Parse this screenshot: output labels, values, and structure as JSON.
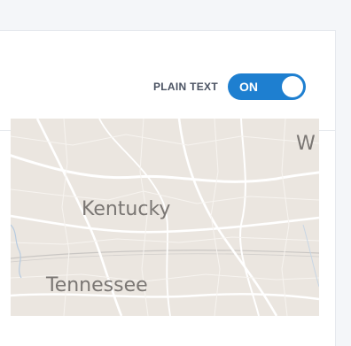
{
  "toolbar": {
    "plain_text_label": "PLAIN TEXT",
    "toggle_state_label": "ON",
    "toggle_on": true,
    "toggle_color": "#1e7fd0"
  },
  "map": {
    "labels": {
      "kentucky": "Kentucky",
      "tennessee": "Tennessee",
      "edge_partial": "W"
    }
  }
}
